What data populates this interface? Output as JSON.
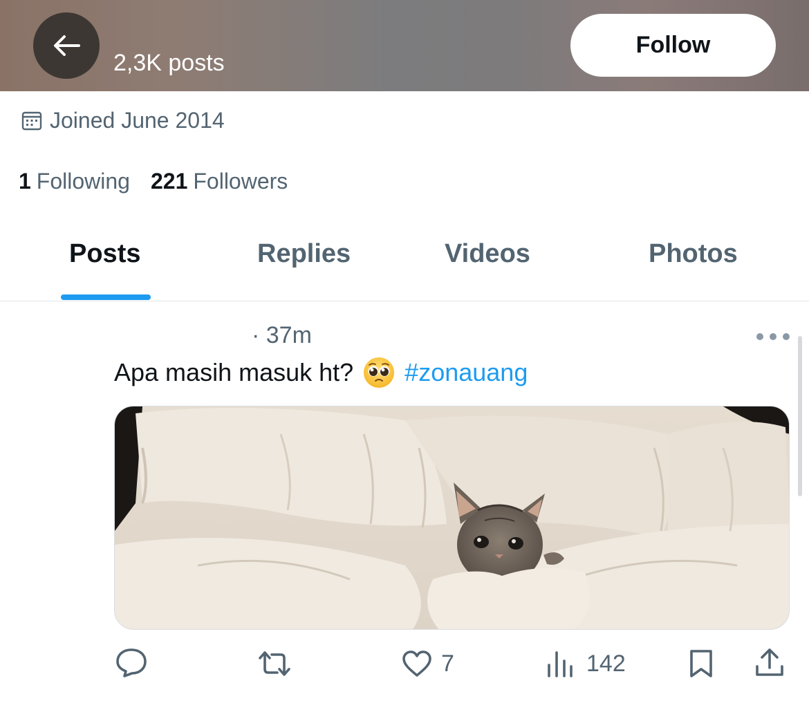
{
  "header": {
    "post_count": "2,3K posts",
    "follow_label": "Follow"
  },
  "profile": {
    "joined": "Joined June 2014",
    "following_count": "1",
    "following_label": "Following",
    "followers_count": "221",
    "followers_label": "Followers"
  },
  "tabs": [
    {
      "label": "Posts",
      "active": true
    },
    {
      "label": "Replies",
      "active": false
    },
    {
      "label": "Videos",
      "active": false
    },
    {
      "label": "Photos",
      "active": false
    }
  ],
  "post": {
    "time": "· 37m",
    "text": "Apa masih masuk ht?",
    "emoji": "pleading-face",
    "hashtag": "#zonauang",
    "media_description": "kitten in white blanket",
    "likes": "7",
    "views": "142"
  },
  "colors": {
    "accent": "#1d9bf0",
    "secondary_text": "#536471",
    "primary_text": "#0f1419"
  }
}
